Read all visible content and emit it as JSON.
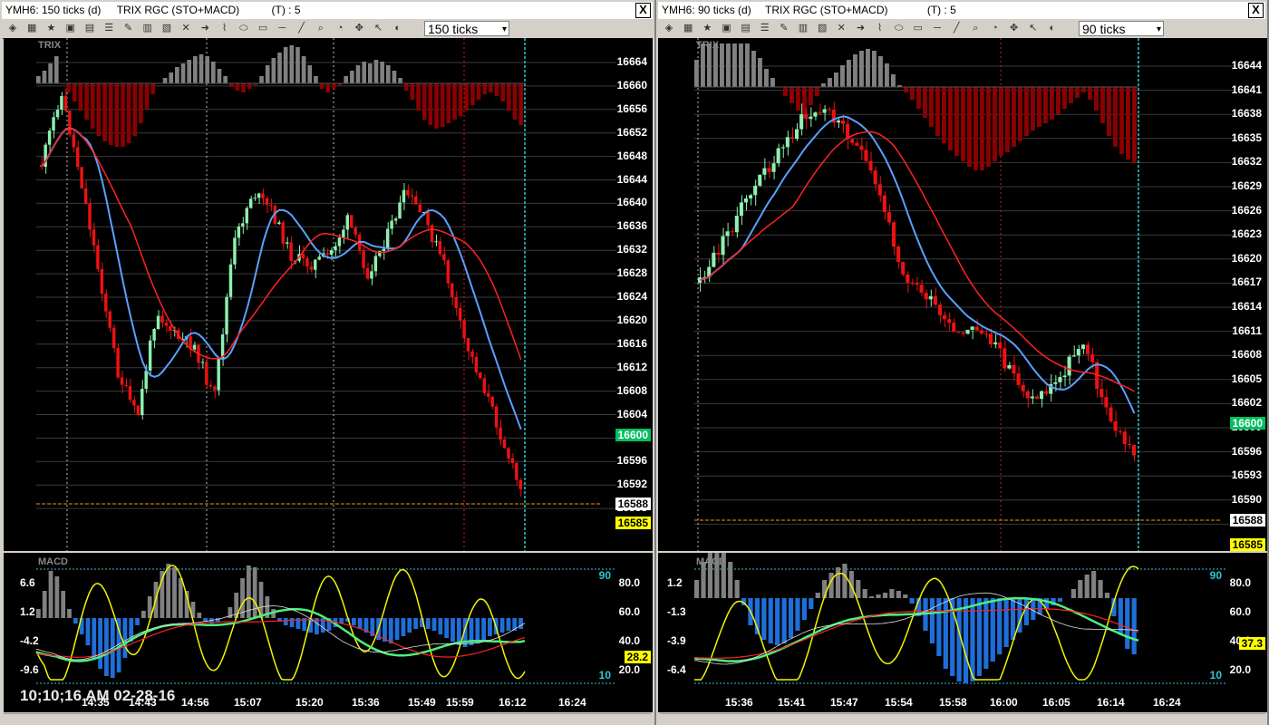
{
  "left": {
    "title_symbol": "YMH6: 150 ticks (d)",
    "title_study": "TRIX RGC (STO+MACD)",
    "title_t": "(T) : 5",
    "close_label": "X",
    "ticks_value": "150 ticks",
    "trix_label": "TRIX",
    "macd_label": "MACD",
    "price_ticks": [
      "16664",
      "16660",
      "16656",
      "16652",
      "16648",
      "16644",
      "16640",
      "16636",
      "16632",
      "16628",
      "16624",
      "16620",
      "16616",
      "16612",
      "16608",
      "16604",
      "16600",
      "16596",
      "16592",
      "16588",
      "16585"
    ],
    "last_price": "16600",
    "tag_white": "16588",
    "tag_yellow": "16585",
    "macd_ticks": [
      "6.6",
      "1.2",
      "-4.2",
      "-9.6"
    ],
    "stoch_ticks": [
      "80.0",
      "60.0",
      "40.0",
      "20.0"
    ],
    "stoch_90": "90",
    "stoch_10": "10",
    "stoch_value": "28.2",
    "time_labels": [
      "14:35",
      "14:43",
      "14:56",
      "15:07",
      "15:20",
      "15:36",
      "15:49",
      "15:59",
      "16:12",
      "16:24"
    ],
    "timestamp": "10;10;16 AM  02-28-16"
  },
  "right": {
    "title_symbol": "YMH6: 90 ticks (d)",
    "title_study": "TRIX RGC (STO+MACD)",
    "title_t": "(T) : 5",
    "close_label": "X",
    "ticks_value": "90 ticks",
    "trix_label": "TRIX",
    "macd_label": "MACD",
    "price_ticks": [
      "16644",
      "16641",
      "16638",
      "16635",
      "16632",
      "16629",
      "16626",
      "16623",
      "16620",
      "16617",
      "16614",
      "16611",
      "16608",
      "16605",
      "16602",
      "16599",
      "16596",
      "16593",
      "16590",
      "16587",
      "16585"
    ],
    "last_price": "16600",
    "tag_white": "16588",
    "tag_yellow": "16585",
    "macd_ticks": [
      "1.2",
      "-1.3",
      "-3.9",
      "-6.4"
    ],
    "stoch_ticks": [
      "80.0",
      "60.0",
      "40.0",
      "20.0"
    ],
    "stoch_90": "90",
    "stoch_10": "10",
    "stoch_value": "37.3",
    "time_labels": [
      "15:36",
      "15:41",
      "15:47",
      "15:54",
      "15:58",
      "16:00",
      "16:05",
      "16:14",
      "16:24"
    ]
  },
  "colors": {
    "up_bar": "#8ef0b0",
    "down_bar": "#ee1111",
    "ma_blue": "#5aa0ff",
    "ma_red": "#ff2222",
    "hist_pos": "#808080",
    "hist_neg_top": "#8b0000",
    "macd_hist_neg": "#1e6fd9",
    "stoch_yellow": "#f4f400",
    "signal_green": "#4cf07a",
    "cyan_line": "#2ec7d6",
    "orange_line": "#ff8c1a",
    "last_price_bg": "#00c060",
    "tag_yellow_bg": "#ffff00"
  },
  "icons": [
    "chart-icon",
    "star-icon",
    "folder-icon",
    "save-icon",
    "crosshair-icon",
    "zoom-icon",
    "draw-line-icon",
    "pointer-icon"
  ]
}
